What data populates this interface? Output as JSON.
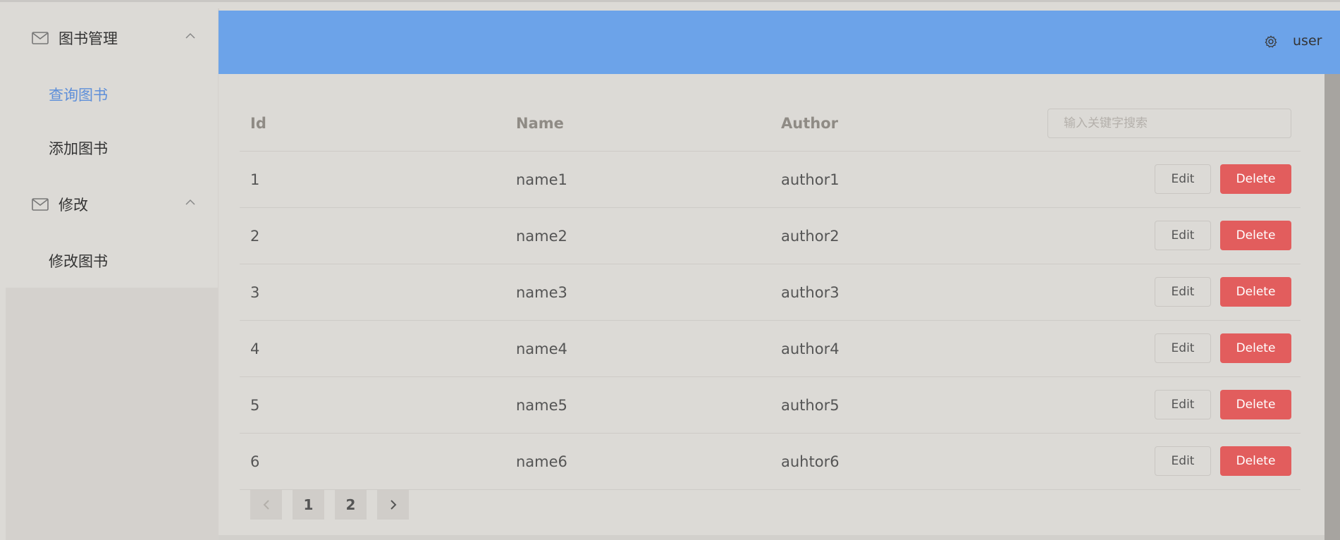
{
  "sidebar": {
    "groups": [
      {
        "title": "图书管理",
        "icon": "mail-icon",
        "items": [
          "查询图书",
          "添加图书"
        ],
        "active_item": "查询图书"
      },
      {
        "title": "修改",
        "icon": "mail-icon",
        "items": [
          "修改图书"
        ]
      }
    ]
  },
  "header": {
    "settings_icon": "gear-icon",
    "user": "user"
  },
  "table": {
    "columns": [
      "Id",
      "Name",
      "Author"
    ],
    "search_placeholder": "输入关键字搜索",
    "edit_label": "Edit",
    "delete_label": "Delete",
    "rows": [
      {
        "id": "1",
        "name": "name1",
        "author": "author1"
      },
      {
        "id": "2",
        "name": "name2",
        "author": "author2"
      },
      {
        "id": "3",
        "name": "name3",
        "author": "author3"
      },
      {
        "id": "4",
        "name": "name4",
        "author": "author4"
      },
      {
        "id": "5",
        "name": "name5",
        "author": "author5"
      },
      {
        "id": "6",
        "name": "name6",
        "author": "auhtor6"
      }
    ]
  },
  "pagination": {
    "pages": [
      "1",
      "2"
    ],
    "prev_icon": "chevron-left-icon",
    "next_icon": "chevron-right-icon"
  },
  "colors": {
    "header": "#6ca3e9",
    "active_menu": "#5e8fd9",
    "delete_button": "#e25d5d"
  }
}
